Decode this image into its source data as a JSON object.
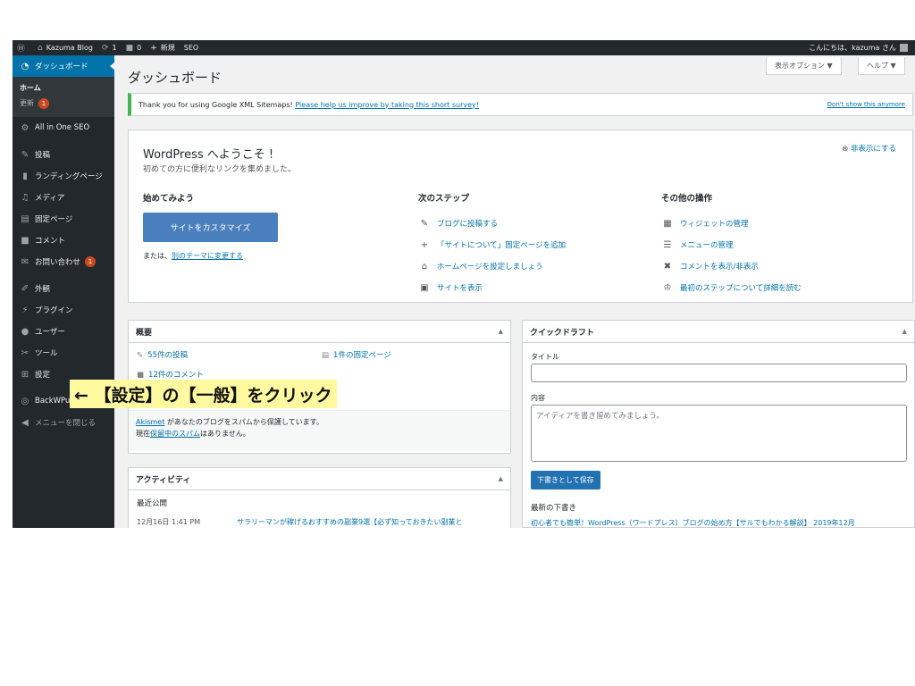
{
  "adminbar": {
    "wp_icon": "wordpress-icon",
    "site_name": "Kazuma Blog",
    "updates_count": "1",
    "comments_count": "0",
    "new_label": "新規",
    "seo_label": "SEO",
    "greeting": "こんにちは、kazuma さん"
  },
  "sidebar": {
    "dashboard": "ダッシュボード",
    "home": "ホーム",
    "updates": "更新",
    "updates_badge": "1",
    "items": [
      {
        "label": "All in One SEO",
        "icon": "gear-icon"
      },
      {
        "label": "投稿",
        "icon": "pin-icon"
      },
      {
        "label": "ランディングページ",
        "icon": "landing-icon"
      },
      {
        "label": "メディア",
        "icon": "media-icon"
      },
      {
        "label": "固定ページ",
        "icon": "page-icon"
      },
      {
        "label": "コメント",
        "icon": "comment-icon"
      },
      {
        "label": "お問い合わせ",
        "icon": "mail-icon",
        "badge": "1"
      },
      {
        "label": "外観",
        "icon": "brush-icon"
      },
      {
        "label": "プラグイン",
        "icon": "plugin-icon"
      },
      {
        "label": "ユーザー",
        "icon": "user-icon"
      },
      {
        "label": "ツール",
        "icon": "wrench-icon"
      },
      {
        "label": "設定",
        "icon": "settings-icon"
      },
      {
        "label": "BackWPup",
        "icon": "backwpup-icon"
      },
      {
        "label": "メニューを閉じる",
        "icon": "collapse-icon"
      }
    ]
  },
  "main": {
    "title": "ダッシュボード",
    "screen_options": "表示オプション ▼",
    "help": "ヘルプ ▼",
    "notice": {
      "text": "Thank you for using Google XML Sitemaps! ",
      "link": "Please help us improve by taking this short survey!",
      "dismiss": "Don't show this anymore"
    },
    "welcome": {
      "title": "WordPress へようこそ !",
      "about": "初めての方に便利なリンクを集めました。",
      "hide": "非表示にする",
      "col1_title": "始めてみよう",
      "customize_btn": "サイトをカスタマイズ",
      "or_text": "または、",
      "or_link": "別のテーマに変更する",
      "col2_title": "次のステップ",
      "col2_links": [
        "ブログに投稿する",
        "「サイトについて」固定ページを追加",
        "ホームページを設定しましょう",
        "サイトを表示"
      ],
      "col3_title": "その他の操作",
      "col3_links": [
        "ウィジェットの管理",
        "メニューの管理",
        "コメントを表示/非表示",
        "最初のステップについて詳細を読む"
      ]
    },
    "glance": {
      "title": "概要",
      "posts": "55件の投稿",
      "pages": "1件の固定ページ",
      "comments": "12件のコメント",
      "akismet_link": "Akismet",
      "akismet_text": " があなたのブログをスパムから保護しています。",
      "spam_prefix": "現在",
      "spam_link": "保留中のスパム",
      "spam_suffix": "はありません。"
    },
    "quickdraft": {
      "title": "クイックドラフト",
      "title_label": "タイトル",
      "content_label": "内容",
      "content_placeholder": "アイディアを書き留めてみましょう。",
      "save": "下書きとして保存",
      "recent": "最新の下書き",
      "recent_item": "初心者でも簡単！WordPress（ワードプレス）ブログの始め方【サルでもわかる解説】 2019年12月"
    },
    "activity": {
      "title": "アクティビティ",
      "recent": "最近公開",
      "date": "12月16日 1:41 PM",
      "post": "サラリーマンが稼げるおすすめの副業9選【必ず知っておきたい副業と"
    }
  },
  "annotation": "← 【設定】の【一般】をクリック"
}
